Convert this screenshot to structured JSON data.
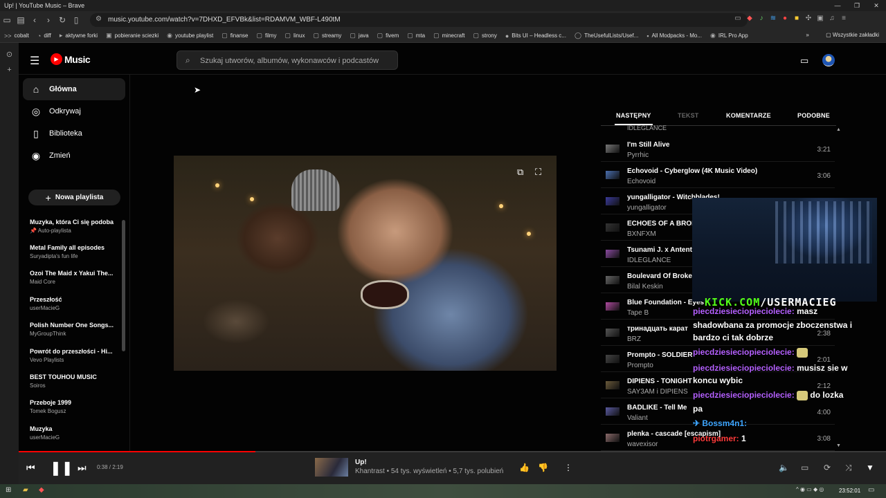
{
  "window": {
    "title": "Up! | YouTube Music – Brave",
    "controls": [
      "—",
      "❐",
      "✕"
    ]
  },
  "browser": {
    "url": "music.youtube.com/watch?v=7DHXD_EFVBk&list=RDAMVM_WBF-L490tM",
    "bookmarks": [
      {
        "icon": ">>",
        "label": "cobalt"
      },
      {
        "icon": "◔",
        "label": "diff"
      },
      {
        "icon": "▸",
        "label": "aktywne forki"
      },
      {
        "icon": "▣",
        "label": "pobieranie sciezki"
      },
      {
        "icon": "◉",
        "label": "youtube playlist"
      },
      {
        "icon": "▢",
        "label": "finanse"
      },
      {
        "icon": "▢",
        "label": "filmy"
      },
      {
        "icon": "▢",
        "label": "linux"
      },
      {
        "icon": "▢",
        "label": "streamy"
      },
      {
        "icon": "▢",
        "label": "java"
      },
      {
        "icon": "▢",
        "label": "fivem"
      },
      {
        "icon": "▢",
        "label": "mta"
      },
      {
        "icon": "▢",
        "label": "minecraft"
      },
      {
        "icon": "▢",
        "label": "strony"
      },
      {
        "icon": "●",
        "label": "Bits UI – Headless c..."
      },
      {
        "icon": "◯",
        "label": "TheUsefulLists/Usef..."
      },
      {
        "icon": "▪",
        "label": "All Modpacks - Mo..."
      },
      {
        "icon": "◉",
        "label": "IRL Pro App"
      }
    ],
    "bookmarks_more": "»",
    "bookmarks_all": "Wszystkie zakładki"
  },
  "header": {
    "logo_text": "Music",
    "search_placeholder": "Szukaj utworów, albumów, wykonawców i podcastów"
  },
  "nav": [
    {
      "icon": "⌂",
      "label": "Główna"
    },
    {
      "icon": "◎",
      "label": "Odkrywaj"
    },
    {
      "icon": "▯",
      "label": "Biblioteka"
    },
    {
      "icon": "◉",
      "label": "Zmień"
    }
  ],
  "new_playlist": "Nowa playlista",
  "playlists": [
    {
      "title": "Muzyka, która Ci się podoba",
      "subtitle": "📌 Auto-playlista"
    },
    {
      "title": "Metal Family all episodes",
      "subtitle": "Suryadipta's fun life"
    },
    {
      "title": "Ozoi The Maid x Yakui The...",
      "subtitle": "Maid Core"
    },
    {
      "title": "Przeszłość",
      "subtitle": "userMacieG"
    },
    {
      "title": "Polish Number One Songs...",
      "subtitle": "MyGroupThink"
    },
    {
      "title": "Powrót do przeszłości - Hi...",
      "subtitle": "Vevo Playlists"
    },
    {
      "title": "BEST TOUHOU MUSIC",
      "subtitle": "Soiros"
    },
    {
      "title": "Przeboje 1999",
      "subtitle": "Tomek Bogusz"
    },
    {
      "title": "Muzyka",
      "subtitle": "userMacieG"
    }
  ],
  "tabs": [
    {
      "label": "NASTĘPNY",
      "state": "active"
    },
    {
      "label": "TEKST",
      "state": "disabled"
    },
    {
      "label": "KOMENTARZE",
      "state": "normal"
    },
    {
      "label": "PODOBNE",
      "state": "normal"
    }
  ],
  "queue_top_artist": "IDLEGLANCE",
  "queue": [
    {
      "title": "I'm Still Alive",
      "artist": "Pyrrhic",
      "duration": "3:21"
    },
    {
      "title": "Echovoid - Cyberglow (4K Music Video)",
      "artist": "Echovoid",
      "duration": "3:06"
    },
    {
      "title": "yungalligator - Witchblades!",
      "artist": "yungalligator",
      "duration": ""
    },
    {
      "title": "ECHOES OF A BROK",
      "artist": "BXNFXM",
      "duration": ""
    },
    {
      "title": "Tsunami J. x Antent",
      "artist": "IDLEGLANCE",
      "duration": ""
    },
    {
      "title": "Boulevard Of Broker",
      "artist": "Bilal Keskin",
      "duration": ""
    },
    {
      "title": "Blue Foundation - Eyes",
      "artist": "Tape B",
      "duration": ""
    },
    {
      "title": "тринадцать карат",
      "artist": "BRZ",
      "duration": "2:38"
    },
    {
      "title": "Prompto - SOLDIER",
      "artist": "Prompto",
      "duration": "2:01"
    },
    {
      "title": "DIPIENS - TONIGHT",
      "artist": "SAY3AM i DIPIENS",
      "duration": "2:12"
    },
    {
      "title": "BADLIKE - Tell Me",
      "artist": "Valiant",
      "duration": "4:00"
    },
    {
      "title": "plenka - cascade [escapism]",
      "artist": "wavexisor",
      "duration": "3:08"
    }
  ],
  "overlay": {
    "kick_prefix": "KICK.COM",
    "kick_channel": "/USERMACIEG",
    "chat": [
      {
        "user": "piecdziesieciopieciolecie:",
        "text": " masz"
      },
      {
        "user": "",
        "text": "shadowbana za promocje zboczenstwa i"
      },
      {
        "user": "",
        "text": "bardzo ci tak dobrze"
      },
      {
        "user": "piecdziesieciopieciolecie:",
        "text": ""
      },
      {
        "user": "piecdziesieciopieciolecie:",
        "text": " musisz sie w"
      },
      {
        "user": "",
        "text": "koncu wybic"
      },
      {
        "user": "piecdziesieciopieciolecie:",
        "text": "  do lozka"
      },
      {
        "user": "",
        "text": "pa"
      },
      {
        "user": "✈ Bossm4n1:",
        "text": ""
      },
      {
        "user": "piotrgamer:",
        "text": " 1"
      }
    ]
  },
  "player": {
    "time": "0:38 / 2:19",
    "progress_fraction": 0.273,
    "title": "Up!",
    "meta": "Khantrast • 54 tys. wyświetleń • 5,7 tys. polubień"
  },
  "taskbar": {
    "clock": "23:52:01"
  }
}
